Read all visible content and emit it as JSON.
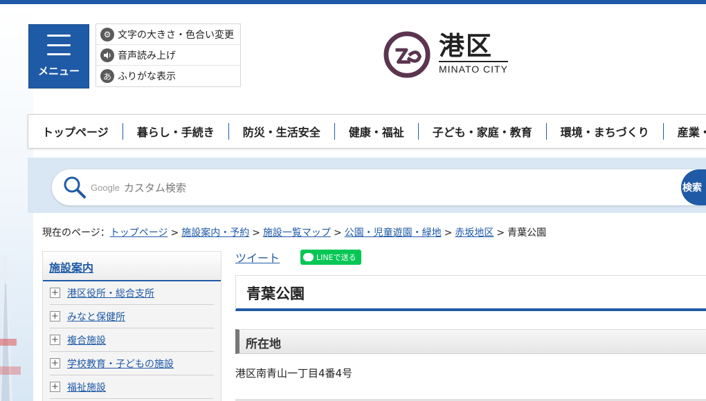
{
  "header": {
    "menu_label": "メニュー",
    "tools": [
      {
        "icon": "gear-icon",
        "label": "文字の大きさ・色合い変更"
      },
      {
        "icon": "speaker-icon",
        "label": "音声読み上げ"
      },
      {
        "icon": "furigana-icon",
        "label": "ふりがな表示"
      }
    ],
    "logo": {
      "jp": "港区",
      "en": "MINATO CITY"
    }
  },
  "global_nav": [
    "トップページ",
    "暮らし・手続き",
    "防災・生活安全",
    "健康・福祉",
    "子ども・家庭・教育",
    "環境・まちづくり",
    "産業・"
  ],
  "search": {
    "brand": "Google",
    "placeholder": "カスタム検索",
    "button_label": "検索"
  },
  "breadcrumb": {
    "prefix": "現在のページ：",
    "links": [
      "トップページ",
      "施設案内・予約",
      "施設一覧マップ",
      "公園・児童遊園・緑地",
      "赤坂地区"
    ],
    "current": "青葉公園"
  },
  "sidebar": {
    "title": "施設案内",
    "items": [
      "港区役所・総合支所",
      "みなと保健所",
      "複合施設",
      "学校教育・子どもの施設",
      "福祉施設"
    ]
  },
  "share": {
    "tweet_label": "ツイート",
    "line_label": "LINEで送る"
  },
  "content": {
    "title": "青葉公園",
    "section_heading": "所在地",
    "address": "港区南青山一丁目4番4号"
  },
  "colors": {
    "brand_blue": "#1f5aa6",
    "logo_purple": "#5b3550",
    "line_green": "#06c755"
  }
}
